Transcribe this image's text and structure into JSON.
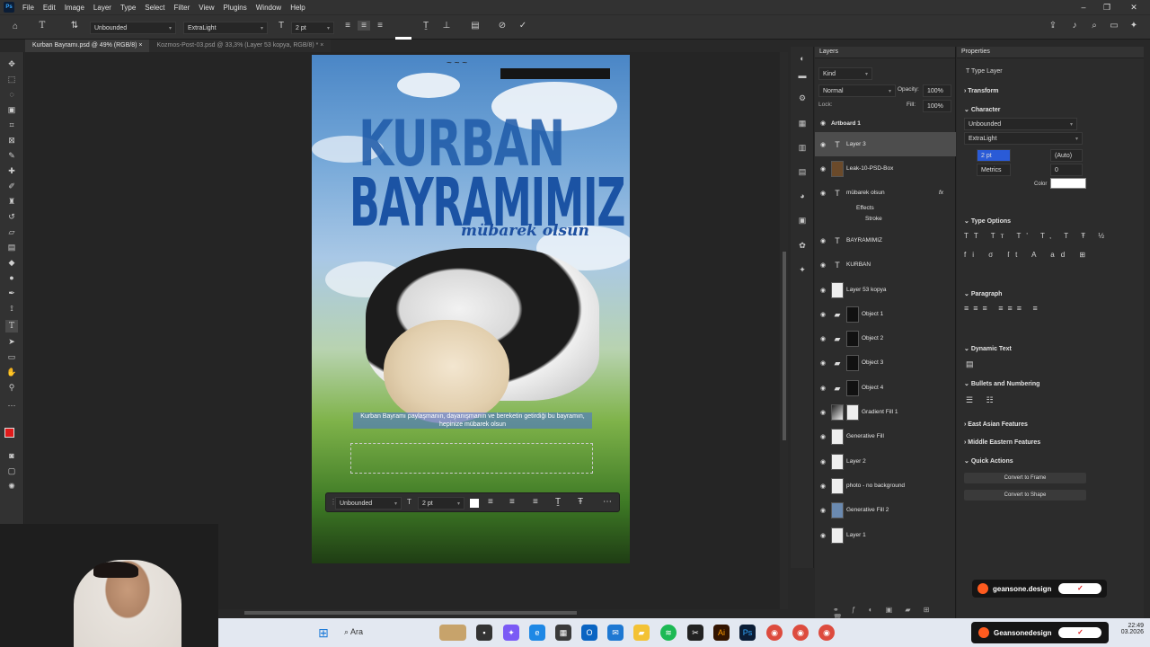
{
  "menu": {
    "app_logo": "Ps",
    "items": [
      "File",
      "Edit",
      "Image",
      "Layer",
      "Type",
      "Select",
      "Filter",
      "View",
      "Plugins",
      "Window",
      "Help"
    ]
  },
  "options_bar": {
    "font_family": "Unbounded",
    "font_style": "ExtraLight",
    "font_size": "2 pt"
  },
  "tabs": [
    {
      "label": "Kurban Bayramı.psd @ 49% (RGB/8)"
    },
    {
      "label": "Kozmos-Post-03.psd @ 33,3% (Layer 53 kopya, RGB/8) *"
    }
  ],
  "artboard": {
    "title_line1": "KURBAN",
    "title_line2": "BAYRAMIMIZ",
    "subtitle": "mübarek olsun",
    "selected_text": "Kurban Bayramı paylaşmanın, dayanışmanın ve bereketin getirdiği bu bayramın, hepinize mübarek olsun"
  },
  "context_bar": {
    "font": "Unbounded",
    "size": "2 pt"
  },
  "layers_panel": {
    "title": "Layers",
    "search_placeholder": "Kind",
    "blend_mode": "Normal",
    "opacity_label": "Opacity:",
    "opacity_value": "100%",
    "fill_label": "Fill:",
    "fill_value": "100%",
    "lock_label": "Lock:",
    "artboard": "Artboard 1",
    "layers": [
      {
        "name": "Layer 3",
        "kind": "text",
        "selected": true
      },
      {
        "name": "Leak-10-PSD-Box",
        "kind": "image"
      },
      {
        "name": "mübarek olsun",
        "kind": "text",
        "fx": "fx"
      },
      {
        "name": "Effects",
        "kind": "effects"
      },
      {
        "name": "Stroke",
        "kind": "effect"
      },
      {
        "name": "BAYRAMIMIZ",
        "kind": "text"
      },
      {
        "name": "KURBAN",
        "kind": "text"
      },
      {
        "name": "Layer 53 kopya",
        "kind": "image"
      },
      {
        "name": "Object 1",
        "kind": "group"
      },
      {
        "name": "Object 2",
        "kind": "group"
      },
      {
        "name": "Object 3",
        "kind": "group"
      },
      {
        "name": "Object 4",
        "kind": "group"
      },
      {
        "name": "Gradient Fill 1",
        "kind": "fill"
      },
      {
        "name": "Generative Fill",
        "kind": "image"
      },
      {
        "name": "Layer 2",
        "kind": "image"
      },
      {
        "name": "photo - no background",
        "kind": "image"
      },
      {
        "name": "Generative Fill 2",
        "kind": "image"
      },
      {
        "name": "Layer 1",
        "kind": "image"
      }
    ]
  },
  "properties_panel": {
    "title": "Properties",
    "layer_type": "Type Layer",
    "transform": "Transform",
    "character": "Character",
    "font_family": "Unbounded",
    "font_style": "ExtraLight",
    "font_size": "2 pt",
    "leading": "(Auto)",
    "kerning": "Metrics",
    "tracking": "0",
    "color_label": "Color",
    "type_options": "Type Options",
    "paragraph": "Paragraph",
    "dynamic_text": "Dynamic Text",
    "bullets": "Bullets and Numbering",
    "east_asian": "East Asian Features",
    "middle_eastern": "Middle Eastern Features",
    "quick_actions": "Quick Actions",
    "convert_frame": "Convert to Frame",
    "convert_shape": "Convert to Shape"
  },
  "watermark": {
    "name1": "geansone.design",
    "name2": "Geansonedesign"
  },
  "taskbar": {
    "search_placeholder": "Ara",
    "time": "22:49",
    "date": "03.2026"
  },
  "colors": {
    "accent": "#1f6feb",
    "title_blue": "#1b53a4",
    "foreground_swatch": "#e01b1b"
  }
}
